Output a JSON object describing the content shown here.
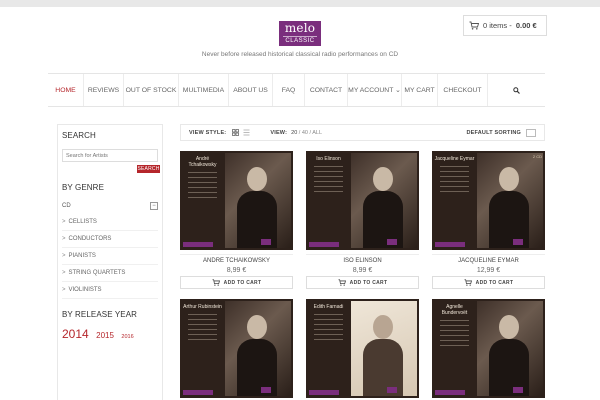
{
  "brand": {
    "logo_line1": "melo",
    "logo_line2": "CLASSIC",
    "tagline": "Never before released historical classical radio performances on CD"
  },
  "cart": {
    "items": "0 items",
    "separator": " - ",
    "amount": "0.00 €"
  },
  "nav": {
    "items": [
      {
        "label": "HOME",
        "active": true
      },
      {
        "label": "REVIEWS"
      },
      {
        "label": "OUT OF STOCK"
      },
      {
        "label": "MULTIMEDIA"
      },
      {
        "label": "ABOUT US"
      },
      {
        "label": "FAQ"
      },
      {
        "label": "CONTACT"
      },
      {
        "label": "MY ACCOUNT ⌄"
      },
      {
        "label": "MY CART"
      },
      {
        "label": "CHECKOUT"
      }
    ]
  },
  "sidebar": {
    "search_title": "SEARCH",
    "search_placeholder": "Search for Artists",
    "search_button": "SEARCH",
    "genre_title": "BY GENRE",
    "genre_root": "CD",
    "genre_toggle": "−",
    "genres": [
      "CELLISTS",
      "CONDUCTORS",
      "PIANISTS",
      "STRING QUARTETS",
      "VIOLINISTS"
    ],
    "year_title": "BY RELEASE YEAR",
    "years": [
      "2014",
      "2015",
      "2016"
    ]
  },
  "toolbar": {
    "view_style_label": "VIEW STYLE:",
    "view_label": "VIEW:",
    "view_selected": "20",
    "view_options": "/ 40 / ALL",
    "sort_label": "DEFAULT SORTING"
  },
  "products": [
    {
      "name": "ANDRE TCHAIKOWSKY",
      "price": "8,99 €",
      "add": "ADD TO CART",
      "cover_name": "André Tchaikowsky"
    },
    {
      "name": "ISO ELINSON",
      "price": "8,99 €",
      "add": "ADD TO CART",
      "cover_name": "Iso Elinson"
    },
    {
      "name": "JACQUELINE EYMAR",
      "price": "12,99 €",
      "add": "ADD TO CART",
      "cover_name": "Jacqueline Eymar",
      "badge": "2 CD"
    },
    {
      "name": "",
      "price": "",
      "add": "",
      "cover_name": "Arthur Rubinstein"
    },
    {
      "name": "",
      "price": "",
      "add": "",
      "cover_name": "Edith Farnadi"
    },
    {
      "name": "",
      "price": "",
      "add": "",
      "cover_name": "Agnelle Bundervoët"
    }
  ],
  "colors": {
    "accent": "#b5262b",
    "brand": "#7a2e7d",
    "cover_bg": "#2d211b"
  }
}
